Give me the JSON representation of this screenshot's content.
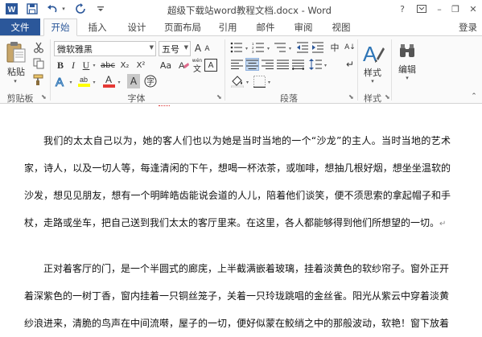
{
  "window": {
    "title": "超级下载站word教程文档.docx - Word",
    "help": "?",
    "minimize": "–",
    "restore": "❐",
    "close": "✕"
  },
  "quick_access": {
    "save_icon": "save-icon",
    "undo_icon": "undo-icon",
    "redo_icon": "redo-icon",
    "customize_icon": "customize-icon"
  },
  "tabs": {
    "file": "文件",
    "items": [
      "开始",
      "插入",
      "设计",
      "页面布局",
      "引用",
      "邮件",
      "审阅",
      "视图"
    ],
    "active": "开始",
    "login": "登录"
  },
  "ribbon": {
    "clipboard": {
      "label": "剪贴板",
      "paste": "粘贴"
    },
    "font": {
      "label": "字体",
      "font_name": "微软雅黑",
      "font_size": "五号",
      "bold": "B",
      "italic": "I",
      "underline": "U",
      "strike": "abc",
      "subscript": "X₂",
      "superscript": "X²",
      "grow": "A",
      "shrink": "A",
      "change_case": "Aa",
      "clear": "A",
      "wen": "wén",
      "wen_char": "文",
      "highlight": "ab",
      "font_color": "A",
      "char_shade": "A",
      "enclose": "字"
    },
    "paragraph": {
      "label": "段落",
      "zhong_ying": "中",
      "sort": "A↓",
      "show_marks": "↵"
    },
    "styles": {
      "label": "样式",
      "button": "样式"
    },
    "editing": {
      "button": "编辑"
    }
  },
  "document": {
    "paragraph1": "我们的太太自己以为，她的客人们也以为她是当时当地的一个“沙龙”的主人。当时当地的艺术家，诗人，以及一切人等，每逢清闲的下午，想喝一杯浓茶，或咖啡，想抽几根好烟，想坐坐温软的沙发，想见见朋友，想有一个明眸皓齿能说会道的人儿，陪着他们谈笑，便不须思索的拿起帽子和手杖，走路或坐车，把自己送到我们太太的客厅里来。在这里，各人都能够得到他们所想望的一切。",
    "paragraph2_lines": [
      "正对着客厅的门，是一个半圆式的廊庑，上半截满嵌着玻璃，挂着淡黄色的软纱帘子。窗外正开",
      "着深紫色的一树丁香，窗内挂着一只铜丝笼子，关着一只玲珑跳唱的金丝雀。阳光从紫云中穿着淡黄",
      "纱浪进来，清脆的鸟声在中间流啭，屋子的一切，便好似蒙在鲛绡之中的那般波动，软艳！窗下放着"
    ],
    "paragraph_mark": "↵"
  },
  "colors": {
    "accent": "#2b579a",
    "ribbon_bg": "#fafafa",
    "font_color_bar": "#e53935",
    "highlight_bar": "#ffff00"
  }
}
